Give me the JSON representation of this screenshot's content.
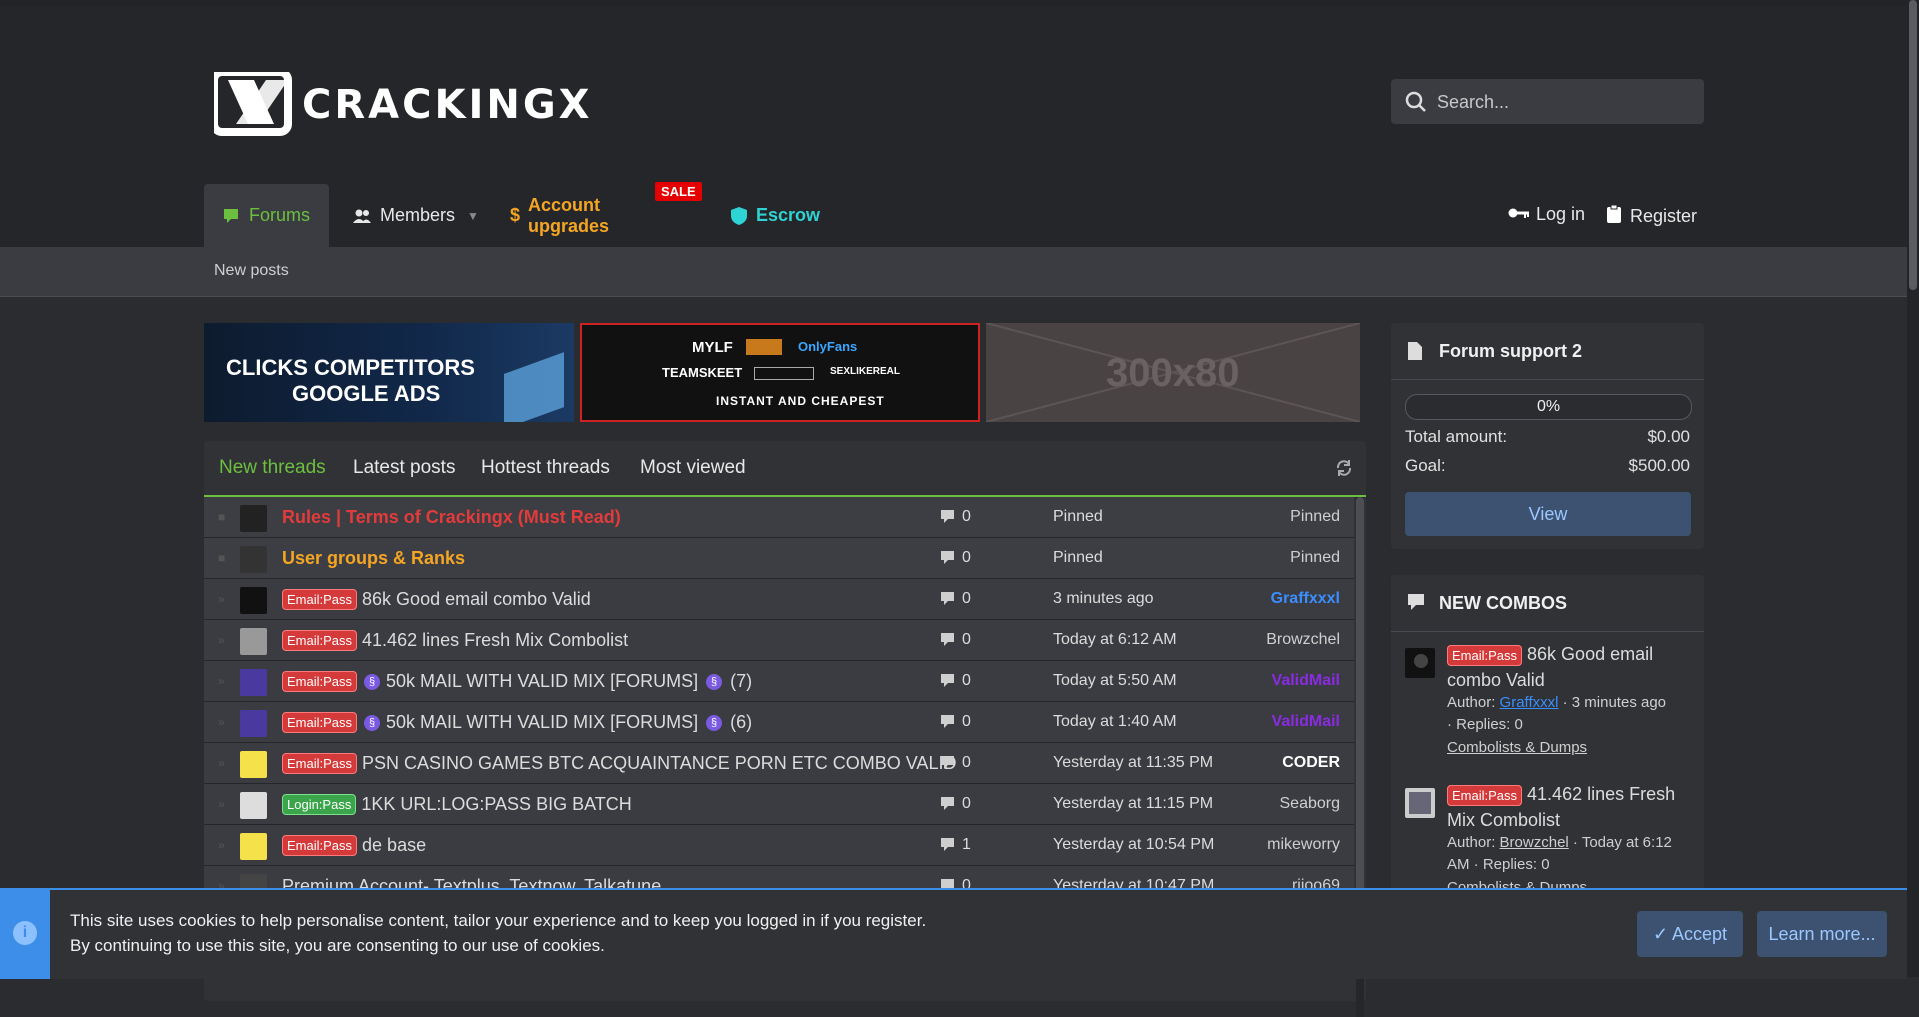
{
  "header": {
    "search_placeholder": "Search...",
    "nav": {
      "forums": "Forums",
      "members": "Members",
      "account_upgrades": "Account upgrades",
      "sale_badge": "SALE",
      "escrow": "Escrow",
      "login": "Log in",
      "register": "Register"
    },
    "subnav": {
      "new_posts": "New posts"
    }
  },
  "colors": {
    "accent_green": "#6dbf3f",
    "upgrade_orange": "#f5a524",
    "escrow_cyan": "#2ed3d3",
    "pinned_red": "#e23b3b",
    "sale_red": "#e40000"
  },
  "banners": {
    "b1_line1": "CLICKS COMPETITORS",
    "b1_line2": "GOOGLE ADS",
    "b2_line1a": "MYLF",
    "b2_line1b": "OnlyFans",
    "b2_line2a": "TEAMSKEET",
    "b2_line2b": "SEXLIKEREAL",
    "b2_line3": "INSTANT AND CHEAPEST",
    "b3": "300x80"
  },
  "tabs": [
    "New threads",
    "Latest posts",
    "Hottest threads",
    "Most viewed"
  ],
  "threads": [
    {
      "prefix": "",
      "title": "Rules | Terms of Crackingx (Must Read)",
      "replies": "0",
      "when": "Pinned",
      "user": "Pinned"
    },
    {
      "prefix": "",
      "title": "User groups & Ranks",
      "replies": "0",
      "when": "Pinned",
      "user": "Pinned"
    },
    {
      "prefix": "Email:Pass",
      "title": "86k Good email combo Valid",
      "replies": "0",
      "when": "3 minutes ago",
      "user": "Graffxxxl"
    },
    {
      "prefix": "Email:Pass",
      "title": "41.462 lines Fresh Mix Combolist",
      "replies": "0",
      "when": "Today at 6:12 AM",
      "user": "Browzchel"
    },
    {
      "prefix": "Email:Pass",
      "title": "50k MAIL WITH VALID MIX [FORUMS]",
      "suffix": "(7)",
      "replies": "0",
      "when": "Today at 5:50 AM",
      "user": "ValidMail"
    },
    {
      "prefix": "Email:Pass",
      "title": "50k MAIL WITH VALID MIX [FORUMS]",
      "suffix": "(6)",
      "replies": "0",
      "when": "Today at 1:40 AM",
      "user": "ValidMail"
    },
    {
      "prefix": "Email:Pass",
      "title": "PSN CASINO GAMES BTC ACQUAINTANCE PORN ETC COMBO VALID",
      "replies": "0",
      "when": "Yesterday at 11:35 PM",
      "user": "CODER"
    },
    {
      "prefix": "Login:Pass",
      "title": "1KK URL:LOG:PASS BIG BATCH",
      "replies": "0",
      "when": "Yesterday at 11:15 PM",
      "user": "Seaborg"
    },
    {
      "prefix": "Email:Pass",
      "title": "de base",
      "replies": "1",
      "when": "Yesterday at 10:54 PM",
      "user": "mikeworry"
    },
    {
      "prefix": "",
      "title": "Premium Account- Textplus, Textnow, Talkatune",
      "replies": "0",
      "when": "Yesterday at 10:47 PM",
      "user": "rijoo69"
    }
  ],
  "support": {
    "title": "Forum support 2",
    "progress_label": "0%",
    "progress_fraction": 0,
    "total_label": "Total amount:",
    "total_value": "$0.00",
    "goal_label": "Goal:",
    "goal_value": "$500.00",
    "view": "View"
  },
  "combos": {
    "title": "NEW COMBOS",
    "items": [
      {
        "prefix": "Email:Pass",
        "title": "86k Good email combo Valid",
        "author_label": "Author:",
        "author": "Graffxxxl",
        "when": "· 3 minutes ago",
        "replies": "· Replies: 0",
        "forum": "Combolists & Dumps"
      },
      {
        "prefix": "Email:Pass",
        "title": "41.462 lines Fresh Mix Combolist",
        "author_label": "Author:",
        "author": "Browzchel",
        "when": "· Today at 6:12 AM · Replies: 0",
        "forum": "Combolists & Dumps"
      }
    ]
  },
  "cookie": {
    "line1": "This site uses cookies to help personalise content, tailor your experience and to keep you logged in if you register.",
    "line2": "By continuing to use this site, you are consenting to our use of cookies.",
    "accept": "Accept",
    "learn_more": "Learn more..."
  }
}
